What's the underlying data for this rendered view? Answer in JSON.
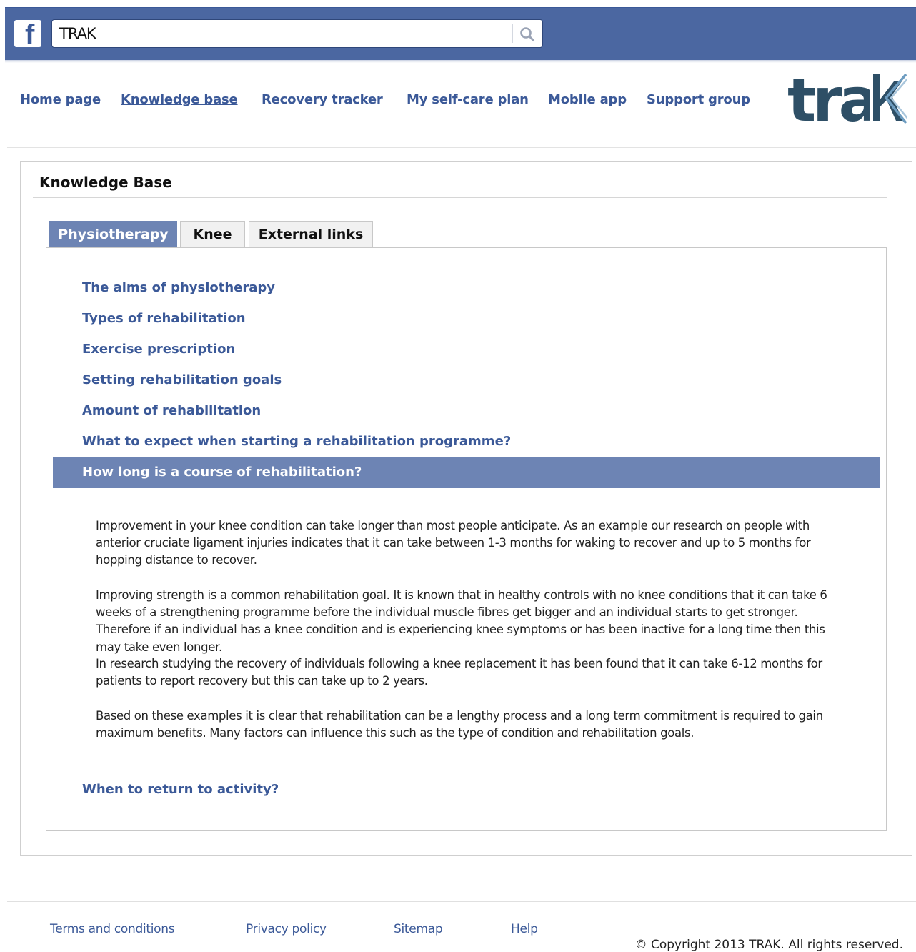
{
  "colors": {
    "facebook_blue": "#4b67a1",
    "link_blue": "#3b5998",
    "active_tab": "#6d84b4",
    "text": "#222222"
  },
  "facebook": {
    "logo_icon": "facebook-f-icon",
    "search": {
      "value": "TRAK",
      "icon": "search-icon"
    }
  },
  "nav": {
    "items": [
      {
        "label": "Home page",
        "active": false
      },
      {
        "label": "Knowledge base",
        "active": true
      },
      {
        "label": "Recovery tracker",
        "active": false
      },
      {
        "label": "My self-care plan",
        "active": false
      },
      {
        "label": "Mobile app",
        "active": false
      },
      {
        "label": "Support group",
        "active": false
      }
    ],
    "brand_logo_text": "trak"
  },
  "main": {
    "title": "Knowledge Base",
    "tabs": [
      {
        "label": "Physiotherapy",
        "active": true
      },
      {
        "label": "Knee",
        "active": false
      },
      {
        "label": "External links",
        "active": false
      }
    ],
    "topics": [
      "The aims of physiotherapy",
      "Types of rehabilitation",
      "Exercise prescription",
      "Setting rehabilitation goals",
      "Amount of rehabilitation",
      "What to expect when starting a rehabilitation programme?"
    ],
    "active_topic": "How long is a course of rehabilitation?",
    "answer": {
      "p1": "Improvement in your knee condition can take longer than most people anticipate. As an example our research on people with anterior cruciate ligament injuries indicates that it can take between 1-3 months for waking to recover and up to 5 months for hopping distance to recover.",
      "p2a": "Improving strength is a common rehabilitation goal. It is known that in healthy controls with no knee conditions that it can take 6 weeks of a strengthening programme before the individual muscle fibres get bigger and an individual starts to get stronger. Therefore if an individual has a knee condition and is experiencing knee symptoms or has been inactive for a long time then this may take even longer.",
      "p2b": "In research studying the recovery of individuals following a knee replacement it has been found that it can take 6-12 months for patients to report recovery but this can take up to 2 years.",
      "p3": "Based on these examples it is clear that rehabilitation can be a lengthy process and a long term commitment is required to gain maximum benefits. Many factors can influence this such as the type of condition and rehabilitation goals."
    },
    "next_topic": "When to return to activity?"
  },
  "footer": {
    "links": [
      "Terms and conditions",
      "Privacy policy",
      "Sitemap",
      "Help"
    ],
    "copyright": "© Copyright 2013 TRAK. All rights reserved."
  }
}
